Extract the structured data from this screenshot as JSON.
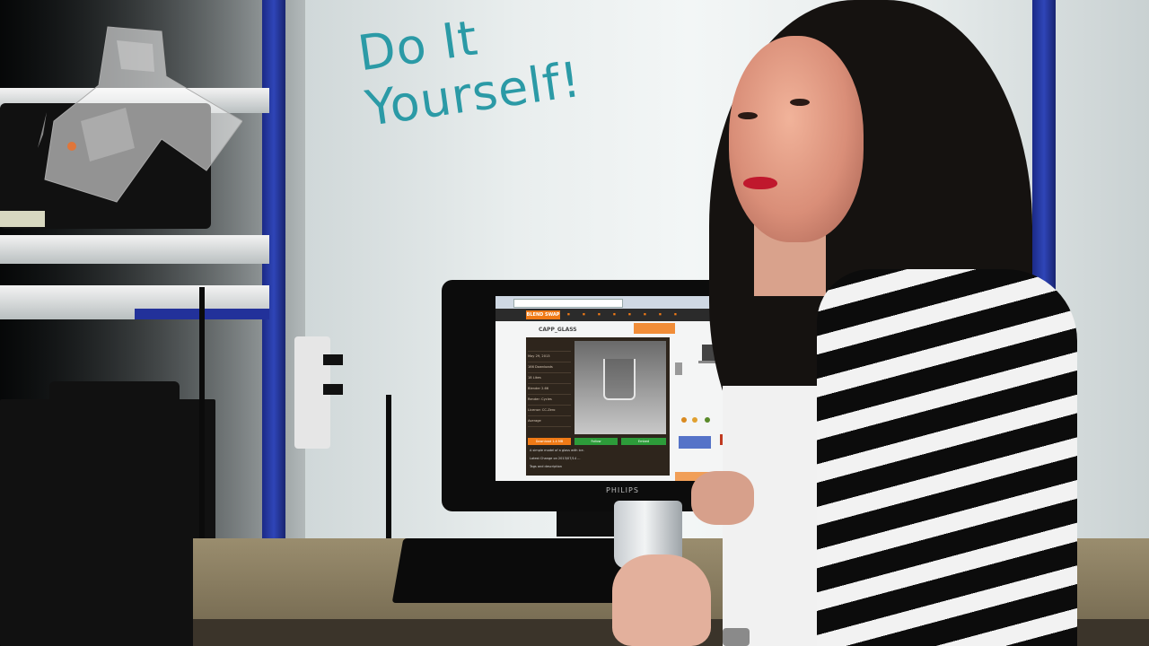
{
  "headline": {
    "line1": "Do It",
    "line2": "Yourself!"
  },
  "monitor": {
    "brand": "PHILIPS"
  },
  "screen": {
    "site_logo": "BLEND SWAP",
    "asset_title": "CAPP_GLASS",
    "nav_items": [
      "",
      "",
      "",
      "",
      "",
      "",
      "",
      ""
    ],
    "sidebar": {
      "author": "",
      "date": "May 29, 2013",
      "downloads": "166 Downloads",
      "likes": "18 Likes",
      "blender": "Blender 2.66",
      "render": "Render: Cycles",
      "license": "License: CC-Zero",
      "rating": "Average"
    },
    "buttons": {
      "download": "Download 1.4 MB",
      "follow": "Follow",
      "embed": "Embed"
    },
    "description": "A simple model of a glass with ice.",
    "edit_line": "Latest Change on 2013/07/14 ...",
    "tags_label": "Tags and description"
  },
  "colors": {
    "headline": "#2b9aa6",
    "accent_orange": "#f07a16",
    "shelf_blue": "#2f45b8"
  }
}
